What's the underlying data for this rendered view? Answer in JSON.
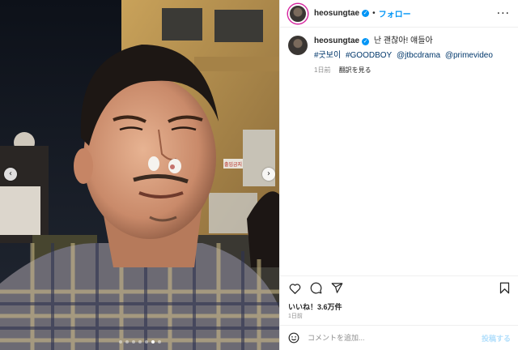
{
  "header": {
    "username": "heosungtae",
    "separator": "•",
    "follow_label": "フォロー",
    "more_icon": "more-horizontal-icon"
  },
  "caption": {
    "username": "heosungtae",
    "text": "난 괜찮아! 얘들아",
    "hashtags": [
      "#굿보이",
      "#GOODBOY",
      "@jtbcdrama",
      "@primevideo"
    ],
    "time_ago": "1日前",
    "translate_label": "翻訳を見る"
  },
  "media": {
    "sign_text": "출입금지",
    "slide_count": 7,
    "active_slide": 5
  },
  "actions": {
    "like_icon": "heart-icon",
    "comment_icon": "comment-icon",
    "share_icon": "send-icon",
    "save_icon": "bookmark-icon"
  },
  "stats": {
    "likes": "いいね！3.6万件",
    "date": "1日前"
  },
  "comment": {
    "placeholder": "コメントを追加...",
    "post_label": "投稿する"
  },
  "colors": {
    "accent": "#0095f6",
    "hashtag": "#00376b",
    "muted": "#8e8e8e",
    "post_disabled": "#b2dffc"
  }
}
